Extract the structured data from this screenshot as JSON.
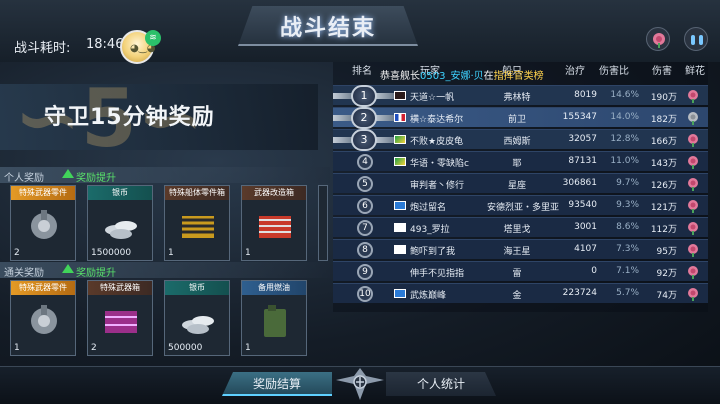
{
  "header": {
    "title": "战斗结束",
    "battle_time_label": "战斗耗时:",
    "battle_time_value": "18:46"
  },
  "rewards": {
    "title": "守卫15分钟奖励",
    "personal": {
      "label": "个人奖励",
      "boost": "奖励提升",
      "items": [
        {
          "name": "特殊武器零件",
          "count": "2",
          "head": "orange"
        },
        {
          "name": "银币",
          "count": "1500000",
          "head": "teal"
        },
        {
          "name": "特殊船体零件箱",
          "count": "1",
          "head": "dark"
        },
        {
          "name": "武器改造箱",
          "count": "1",
          "head": "dark"
        }
      ]
    },
    "pass": {
      "label": "通关奖励",
      "boost": "奖励提升",
      "items": [
        {
          "name": "特殊武器零件",
          "count": "1",
          "head": "orange"
        },
        {
          "name": "特殊武器箱",
          "count": "2",
          "head": "dark"
        },
        {
          "name": "银币",
          "count": "500000",
          "head": "teal"
        },
        {
          "name": "备用燃油",
          "count": "1",
          "head": "blue"
        }
      ]
    }
  },
  "leaderboard": {
    "columns": {
      "rank": "排名",
      "player": "玩家",
      "ship": "船只",
      "heal": "治疗",
      "damage_ratio": "伤害比",
      "damage": "伤害",
      "flower": "鲜花"
    },
    "congrats": {
      "prefix": "恭喜舰长",
      "code": "0503_安娜·贝",
      "suffix": "在",
      "rank_text": "指挥官类榜"
    },
    "rows": [
      {
        "rank": "1",
        "name": "天道☆一帆",
        "ship": "弗林特",
        "value": "8019",
        "ratio": "14.6%",
        "damage": "190万",
        "flag": "dark"
      },
      {
        "rank": "2",
        "name": "横☆泰达希尔",
        "ship": "前卫",
        "value": "155347",
        "ratio": "14.0%",
        "damage": "182万",
        "flag": "fr"
      },
      {
        "rank": "3",
        "name": "不败★皮皮龟",
        "ship": "西姆斯",
        "value": "32057",
        "ratio": "12.8%",
        "damage": "166万",
        "flag": "br"
      },
      {
        "rank": "4",
        "name": "华语・零缺陷c",
        "ship": "耶",
        "value": "87131",
        "ratio": "11.0%",
        "damage": "143万",
        "flag": "br"
      },
      {
        "rank": "5",
        "name": "审判者丶修行",
        "ship": "星座",
        "value": "306861",
        "ratio": "9.7%",
        "damage": "126万",
        "flag": ""
      },
      {
        "rank": "6",
        "name": "炮过留名",
        "ship": "安德烈亚・多里亚",
        "value": "93540",
        "ratio": "9.3%",
        "damage": "121万",
        "flag": "rc"
      },
      {
        "rank": "7",
        "name": "493_罗拉",
        "ship": "塔里戈",
        "value": "3001",
        "ratio": "8.6%",
        "damage": "112万",
        "flag": "kr"
      },
      {
        "rank": "8",
        "name": "鲍吓到了我",
        "ship": "海王星",
        "value": "4107",
        "ratio": "7.3%",
        "damage": "95万",
        "flag": "kr"
      },
      {
        "rank": "9",
        "name": "伸手不见指指",
        "ship": "雷",
        "value": "0",
        "ratio": "7.1%",
        "damage": "92万",
        "flag": ""
      },
      {
        "rank": "10",
        "name": "武炼巅峰",
        "ship": "金",
        "value": "223724",
        "ratio": "5.7%",
        "damage": "74万",
        "flag": "rc"
      }
    ]
  },
  "footer": {
    "tab_reward": "奖励结算",
    "tab_stats": "个人统计"
  }
}
